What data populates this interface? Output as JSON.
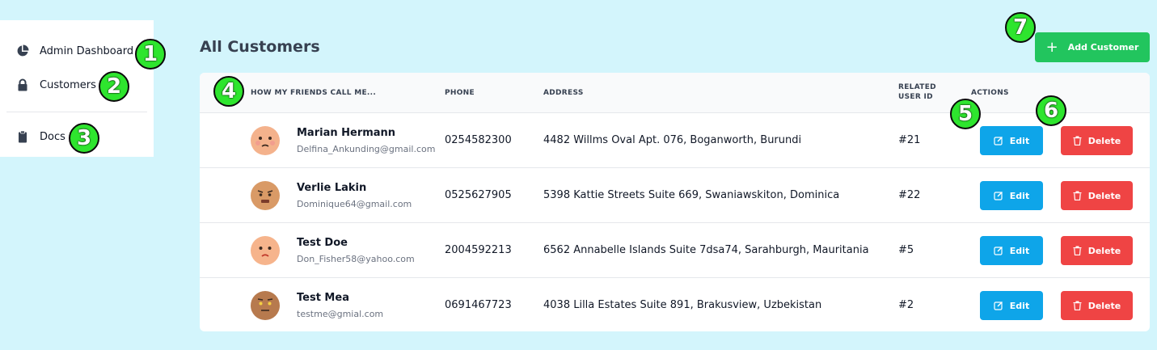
{
  "sidebar": {
    "items": [
      {
        "label": "Admin Dashboard",
        "icon": "pie-chart-icon"
      },
      {
        "label": "Customers",
        "icon": "lock-icon"
      },
      {
        "label": "Docs",
        "icon": "clipboard-icon"
      }
    ]
  },
  "page": {
    "title": "All Customers",
    "add_button_label": "Add Customer"
  },
  "table": {
    "headers": {
      "name": "HOW MY FRIENDS CALL ME...",
      "phone": "PHONE",
      "address": "ADDRESS",
      "related_line1": "RELATED",
      "related_line2": "USER ID",
      "actions": "ACTIONS"
    },
    "edit_label": "Edit",
    "delete_label": "Delete",
    "rows": [
      {
        "name": "Marian Hermann",
        "email": "Delfina_Ankunding@gmail.com",
        "phone": "0254582300",
        "address": "4482 Willms Oval Apt. 076, Boganworth, Burundi",
        "user_id": "#21"
      },
      {
        "name": "Verlie Lakin",
        "email": "Dominique64@gmail.com",
        "phone": "0525627905",
        "address": "5398 Kattie Streets Suite 669, Swaniawskiton, Dominica",
        "user_id": "#22"
      },
      {
        "name": "Test Doe",
        "email": "Don_Fisher58@yahoo.com",
        "phone": "2004592213",
        "address": "6562 Annabelle Islands Suite 7dsa74, Sarahburgh, Mauritania",
        "user_id": "#5"
      },
      {
        "name": "Test Mea",
        "email": "testme@gmial.com",
        "phone": "0691467723",
        "address": "4038 Lilla Estates Suite 891, Brakusview, Uzbekistan",
        "user_id": "#2"
      }
    ]
  },
  "markers": [
    "1",
    "2",
    "3",
    "4",
    "5",
    "6",
    "7"
  ],
  "colors": {
    "background": "#d3f5fc",
    "add_button": "#22c55e",
    "edit_button": "#0ea5e9",
    "delete_button": "#ef4444",
    "marker": "#2ee52e"
  }
}
